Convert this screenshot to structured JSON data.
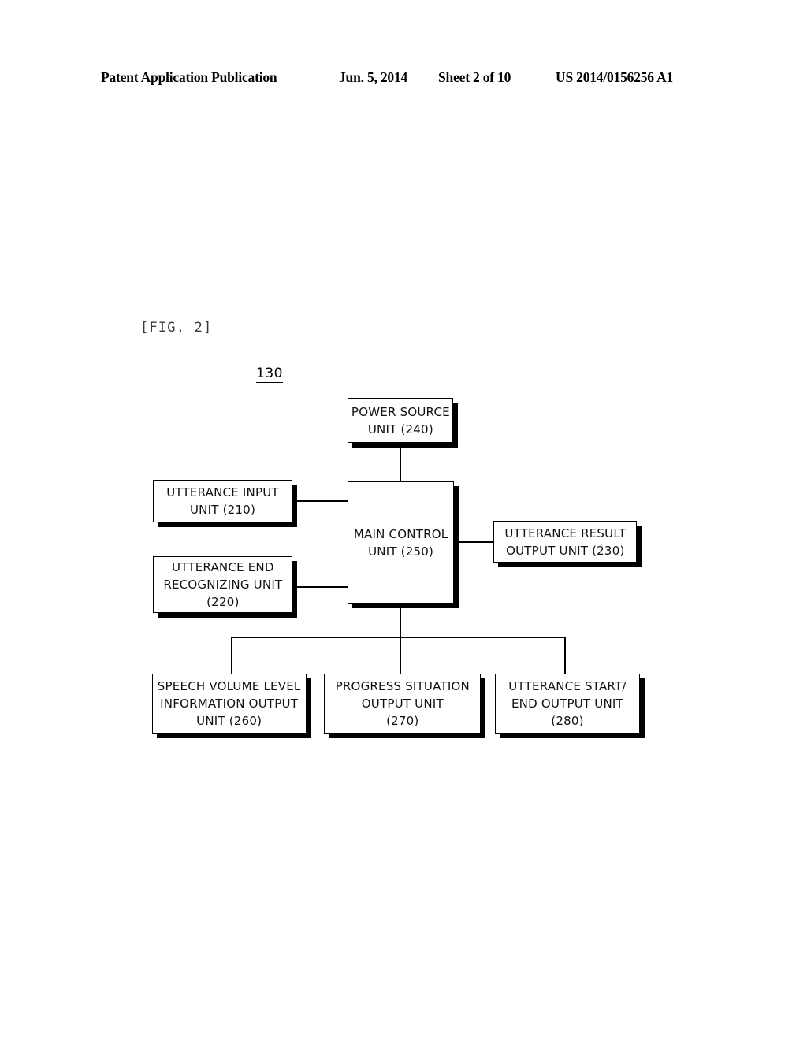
{
  "header": {
    "publication": "Patent Application Publication",
    "date": "Jun. 5, 2014",
    "sheet": "Sheet 2 of 10",
    "patent_number": "US 2014/0156256 A1"
  },
  "figure": {
    "label": "[FIG. 2]",
    "reference_number": "130"
  },
  "diagram": {
    "type": "block-diagram",
    "nodes": [
      {
        "id": "240",
        "label": "POWER SOURCE\nUNIT (240)"
      },
      {
        "id": "210",
        "label": "UTTERANCE INPUT\nUNIT (210)"
      },
      {
        "id": "220",
        "label": "UTTERANCE END\nRECOGNIZING UNIT\n(220)"
      },
      {
        "id": "250",
        "label": "MAIN CONTROL\nUNIT (250)"
      },
      {
        "id": "230",
        "label": "UTTERANCE RESULT\nOUTPUT UNIT (230)"
      },
      {
        "id": "260",
        "label": "SPEECH VOLUME LEVEL\nINFORMATION OUTPUT\nUNIT (260)"
      },
      {
        "id": "270",
        "label": "PROGRESS SITUATION\nOUTPUT UNIT\n(270)"
      },
      {
        "id": "280",
        "label": "UTTERANCE START/\nEND OUTPUT UNIT\n(280)"
      }
    ],
    "connections": [
      {
        "from": "240",
        "to": "250"
      },
      {
        "from": "210",
        "to": "250"
      },
      {
        "from": "220",
        "to": "250"
      },
      {
        "from": "250",
        "to": "230"
      },
      {
        "from": "250",
        "to": "260"
      },
      {
        "from": "250",
        "to": "270"
      },
      {
        "from": "250",
        "to": "280"
      }
    ]
  }
}
